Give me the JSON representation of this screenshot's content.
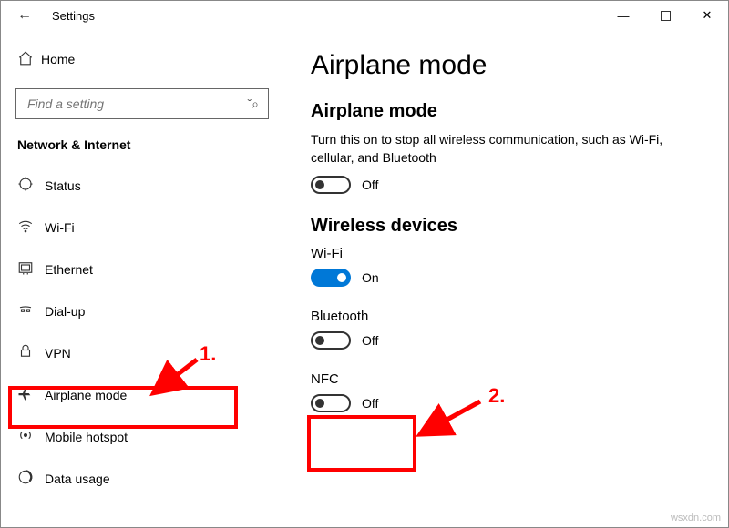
{
  "titlebar": {
    "title": "Settings"
  },
  "sidebar": {
    "home_label": "Home",
    "search_placeholder": "Find a setting",
    "category": "Network & Internet",
    "items": [
      {
        "label": "Status"
      },
      {
        "label": "Wi-Fi"
      },
      {
        "label": "Ethernet"
      },
      {
        "label": "Dial-up"
      },
      {
        "label": "VPN"
      },
      {
        "label": "Airplane mode"
      },
      {
        "label": "Mobile hotspot"
      },
      {
        "label": "Data usage"
      }
    ]
  },
  "page": {
    "title": "Airplane mode",
    "section_airplane": "Airplane mode",
    "airplane_desc": "Turn this on to stop all wireless communication, such as Wi-Fi, cellular, and Bluetooth",
    "airplane_state": "Off",
    "section_wireless": "Wireless devices",
    "wifi_label": "Wi-Fi",
    "wifi_state": "On",
    "bt_label": "Bluetooth",
    "bt_state": "Off",
    "nfc_label": "NFC",
    "nfc_state": "Off"
  },
  "annotations": {
    "num1": "1.",
    "num2": "2."
  },
  "watermark": "wsxdn.com"
}
